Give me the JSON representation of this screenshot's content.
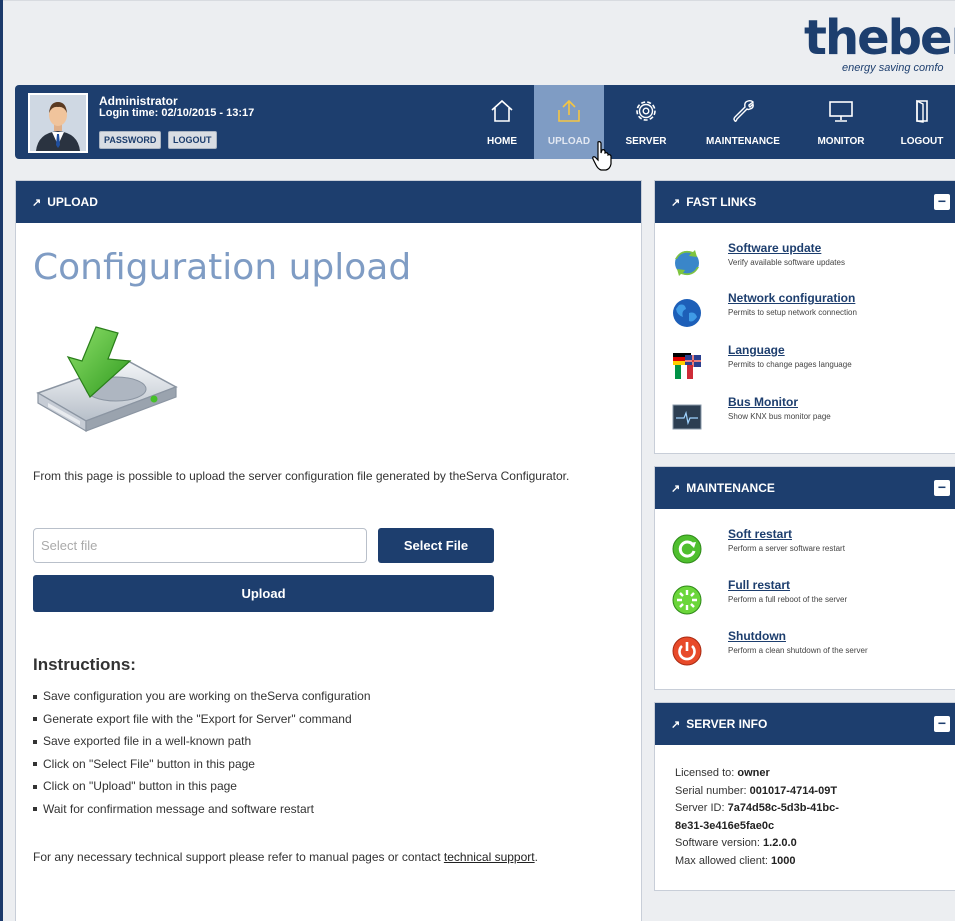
{
  "brand": {
    "name": "theber",
    "tagline": "energy saving comfo"
  },
  "user": {
    "name": "Administrator",
    "login_time": "Login time: 02/10/2015 - 13:17",
    "password_label": "PASSWORD",
    "logout_label": "LOGOUT"
  },
  "nav": {
    "home": "HOME",
    "upload": "UPLOAD",
    "server": "SERVER",
    "maintenance": "MAINTENANCE",
    "monitor": "MONITOR",
    "logout": "LOGOUT",
    "active": "upload"
  },
  "main": {
    "header": "UPLOAD",
    "title": "Configuration upload",
    "description": "From this page is possible to upload the server configuration file generated by theServa Configurator.",
    "file_placeholder": "Select file",
    "select_button": "Select File",
    "upload_button": "Upload",
    "instructions_title": "Instructions:",
    "instructions": [
      "Save configuration you are working on theServa configuration",
      "Generate export file with the \"Export for Server\" command",
      "Save exported file in a well-known path",
      "Click on \"Select File\" button in this page",
      "Click on \"Upload\" button in this page",
      "Wait for confirmation message and software restart"
    ],
    "support_text": "For any necessary technical support please refer to manual pages or contact ",
    "support_link": "technical support",
    "support_end": "."
  },
  "fast_links": {
    "header": "FAST LINKS",
    "items": [
      {
        "title": "Software update",
        "desc": "Verify available software updates",
        "icon": "software-update-icon"
      },
      {
        "title": "Network configuration",
        "desc": "Permits to setup network connection",
        "icon": "globe-icon"
      },
      {
        "title": "Language",
        "desc": "Permits to change pages language",
        "icon": "flags-icon"
      },
      {
        "title": "Bus Monitor",
        "desc": "Show KNX bus monitor page",
        "icon": "bus-monitor-icon"
      }
    ]
  },
  "maintenance": {
    "header": "MAINTENANCE",
    "items": [
      {
        "title": "Soft restart",
        "desc": "Perform a server software restart",
        "icon": "soft-restart-icon"
      },
      {
        "title": "Full restart",
        "desc": "Perform a full reboot of the server",
        "icon": "full-restart-icon"
      },
      {
        "title": "Shutdown",
        "desc": "Perform a clean shutdown of the server",
        "icon": "shutdown-icon"
      }
    ]
  },
  "server_info": {
    "header": "SERVER INFO",
    "licensed_label": "Licensed to: ",
    "licensed_value": "owner",
    "serial_label": "Serial number: ",
    "serial_value": "001017-4714-09T",
    "server_id_label": "Server ID: ",
    "server_id_value_1": "7a74d58c-5d3b-41bc-",
    "server_id_value_2": "8e31-3e416e5fae0c",
    "software_label": "Software version: ",
    "software_value": "1.2.0.0",
    "max_label": "Max allowed client: ",
    "max_value": "1000"
  },
  "colors": {
    "primary": "#1d3e6e",
    "accent": "#7f9cc4",
    "background": "#eceef1"
  }
}
